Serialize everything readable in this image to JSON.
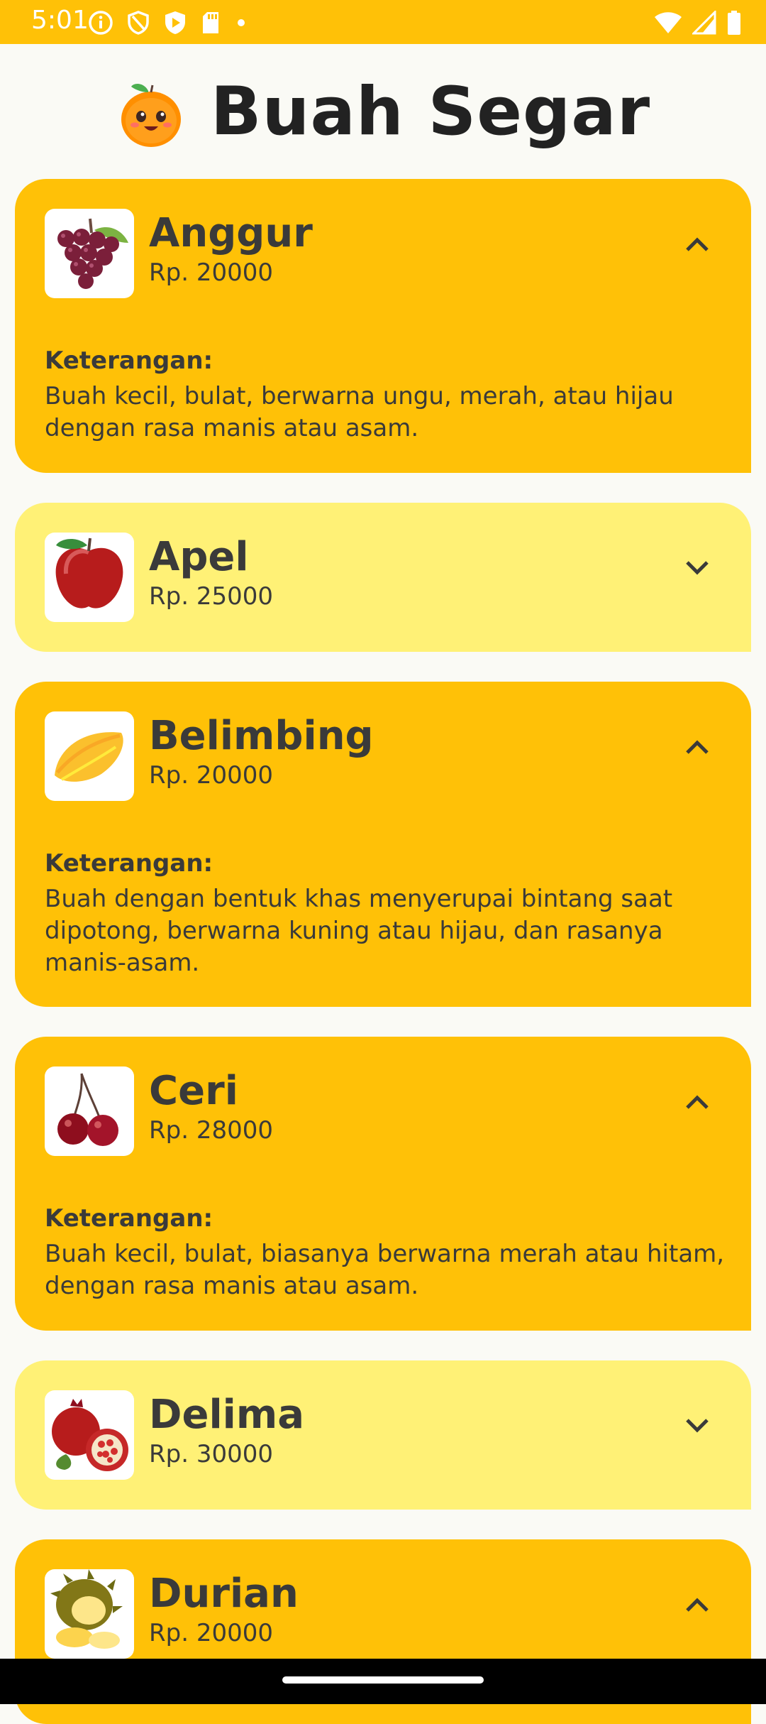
{
  "status_bar": {
    "time": "5:01",
    "left_icons": [
      "info-icon",
      "shield-icon",
      "play-protect-icon",
      "sd-card-icon",
      "dot-icon"
    ],
    "right_icons": [
      "wifi-icon",
      "signal-icon",
      "battery-icon"
    ]
  },
  "header": {
    "title": "Buah Segar",
    "logo": "orange-mascot-icon"
  },
  "colors": {
    "accent": "#FFC107",
    "card_collapsed": "#FFF176",
    "text": "#3A3A3A"
  },
  "fruits": [
    {
      "name": "Anggur",
      "price": "Rp. 20000",
      "expanded": true,
      "icon": "grape-image",
      "desc_label": "Keterangan:",
      "description": "Buah kecil, bulat, berwarna ungu, merah, atau hijau dengan rasa manis atau asam."
    },
    {
      "name": "Apel",
      "price": "Rp. 25000",
      "expanded": false,
      "icon": "apple-image"
    },
    {
      "name": "Belimbing",
      "price": "Rp. 20000",
      "expanded": true,
      "icon": "starfruit-image",
      "desc_label": "Keterangan:",
      "description": "Buah dengan bentuk khas menyerupai bintang saat dipotong, berwarna kuning atau hijau, dan rasanya manis-asam."
    },
    {
      "name": "Ceri",
      "price": "Rp. 28000",
      "expanded": true,
      "icon": "cherry-image",
      "desc_label": "Keterangan:",
      "description": "Buah kecil, bulat, biasanya berwarna merah atau hitam, dengan rasa manis atau asam."
    },
    {
      "name": "Delima",
      "price": "Rp. 30000",
      "expanded": false,
      "icon": "pomegranate-image"
    },
    {
      "name": "Durian",
      "price": "Rp. 20000",
      "expanded": true,
      "icon": "durian-image"
    }
  ]
}
